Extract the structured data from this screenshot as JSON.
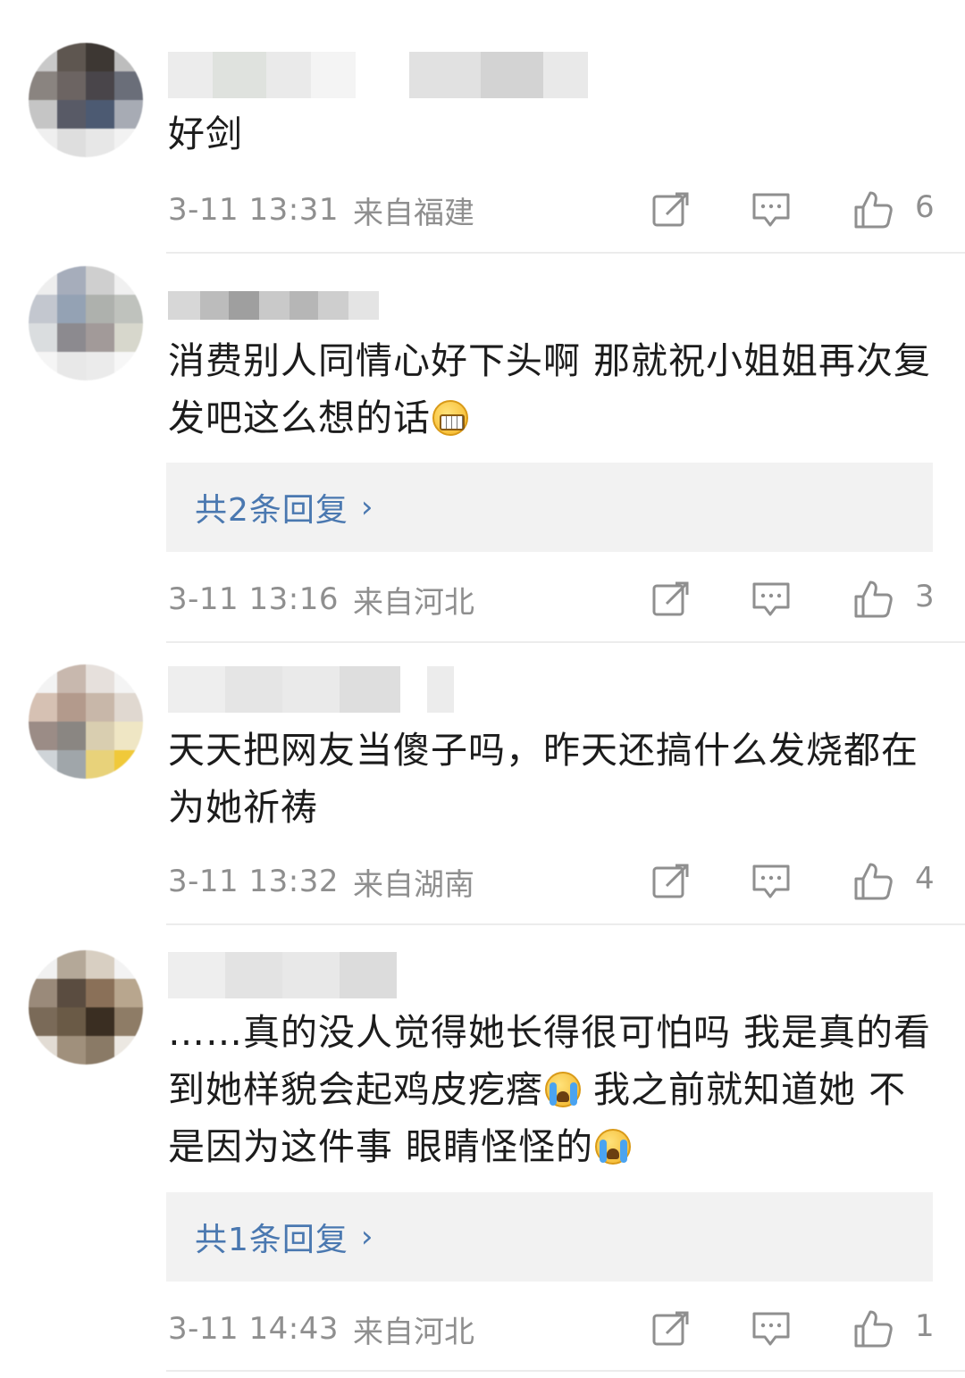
{
  "comments": [
    {
      "content": "好剑",
      "time": "3-11 13:31",
      "location": "来自福建",
      "likes": "6",
      "reply_label": ""
    },
    {
      "content": "消费别人同情心好下头啊 那就祝小姐姐再次复发吧这么想的话",
      "emoji": "grin",
      "time": "3-11 13:16",
      "location": "来自河北",
      "likes": "3",
      "reply_label": "共2条回复"
    },
    {
      "content": "天天把网友当傻子吗，昨天还搞什么发烧都在为她祈祷",
      "time": "3-11 13:32",
      "location": "来自湖南",
      "likes": "4",
      "reply_label": ""
    },
    {
      "content_part1": "……真的没人觉得她长得很可怕吗 我是真的看到她样貌会起鸡皮疙瘩",
      "content_part2": " 我之前就知道她 不是因为这件事 眼睛怪怪的",
      "emoji": "cry",
      "time": "3-11 14:43",
      "location": "来自河北",
      "likes": "1",
      "reply_label": "共1条回复"
    }
  ],
  "icons": {
    "repost": "repost-icon",
    "comment": "comment-icon",
    "like": "thumbs-up-icon",
    "chevron": "chevron-right-icon"
  },
  "colors": {
    "link": "#4a78b0",
    "meta": "#8f8f8f",
    "reply_bg": "#f2f2f2"
  }
}
